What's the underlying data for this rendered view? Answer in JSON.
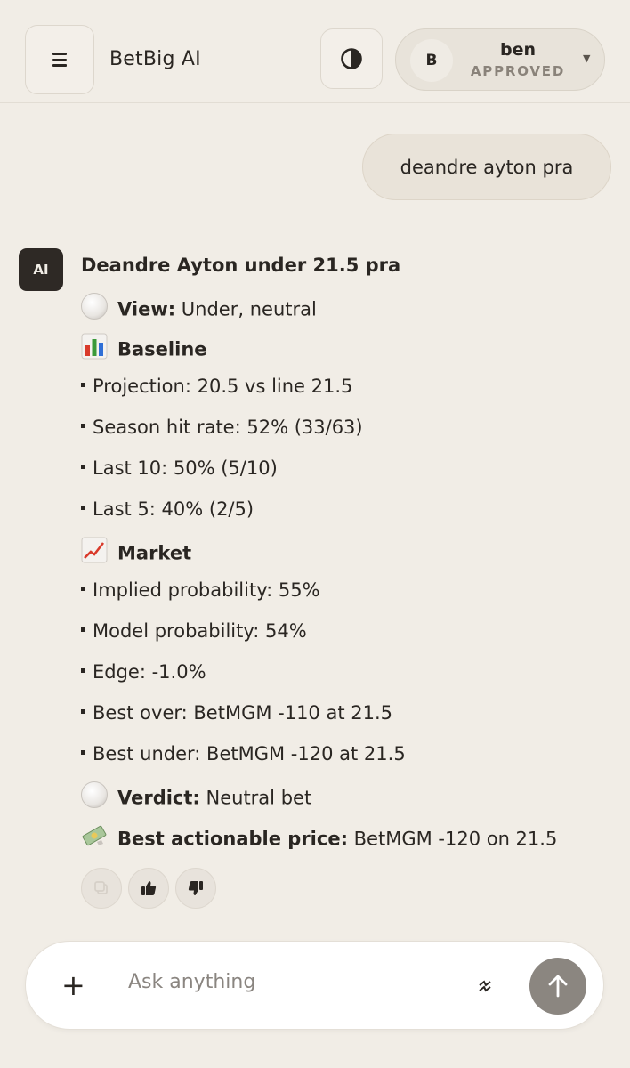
{
  "header": {
    "app_title": "BetBig AI",
    "user": {
      "initial": "B",
      "name": "ben",
      "status": "APPROVED"
    }
  },
  "chat": {
    "user_message": "deandre ayton pra",
    "ai_badge": "AI",
    "reply": {
      "title": "Deandre Ayton under 21.5 pra",
      "view_label": "View:",
      "view_value": " Under, neutral",
      "baseline_heading": "Baseline",
      "baseline_items": [
        "Projection: 20.5 vs line 21.5",
        "Season hit rate: 52% (33/63)",
        "Last 10: 50% (5/10)",
        "Last 5: 40% (2/5)"
      ],
      "market_heading": "Market",
      "market_items": [
        "Implied probability: 55%",
        "Model probability: 54%",
        "Edge: -1.0%",
        "Best over: BetMGM -110 at 21.5",
        "Best under: BetMGM -120 at 21.5"
      ],
      "verdict_label": "Verdict:",
      "verdict_value": " Neutral bet",
      "price_label": "Best actionable price:",
      "price_value": " BetMGM -120 on 21.5"
    }
  },
  "composer": {
    "placeholder": "Ask anything"
  },
  "icons": {
    "menu": "menu-icon",
    "theme": "contrast-icon",
    "dropdown": "chevron-down-icon",
    "copy": "copy-icon",
    "like": "thumbs-up-icon",
    "dislike": "thumbs-down-icon",
    "attach": "plus-icon",
    "voice": "bolt-icon",
    "send": "arrow-up-icon"
  },
  "colors": {
    "background": "#f1ede6",
    "ai_badge": "#2e2925",
    "send_button": "#8b8680"
  }
}
